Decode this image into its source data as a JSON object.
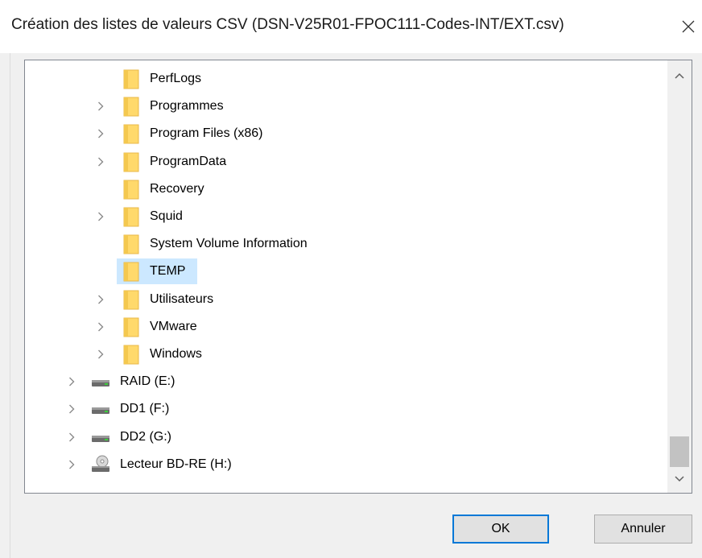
{
  "window": {
    "title": "Création des listes de valeurs CSV (DSN-V25R01-FPOC111-Codes-INT/EXT.csv)"
  },
  "tree": {
    "items": [
      {
        "label": "PerfLogs",
        "type": "folder",
        "expandable": false,
        "selected": false
      },
      {
        "label": "Programmes",
        "type": "folder",
        "expandable": true,
        "selected": false
      },
      {
        "label": "Program Files (x86)",
        "type": "folder",
        "expandable": true,
        "selected": false
      },
      {
        "label": "ProgramData",
        "type": "folder",
        "expandable": true,
        "selected": false
      },
      {
        "label": "Recovery",
        "type": "folder",
        "expandable": false,
        "selected": false
      },
      {
        "label": "Squid",
        "type": "folder",
        "expandable": true,
        "selected": false
      },
      {
        "label": "System Volume Information",
        "type": "folder",
        "expandable": false,
        "selected": false
      },
      {
        "label": "TEMP",
        "type": "folder",
        "expandable": false,
        "selected": true
      },
      {
        "label": "Utilisateurs",
        "type": "folder",
        "expandable": true,
        "selected": false
      },
      {
        "label": "VMware",
        "type": "folder",
        "expandable": true,
        "selected": false
      },
      {
        "label": "Windows",
        "type": "folder",
        "expandable": true,
        "selected": false
      },
      {
        "label": "RAID (E:)",
        "type": "drive",
        "expandable": true,
        "selected": false
      },
      {
        "label": "DD1 (F:)",
        "type": "drive",
        "expandable": true,
        "selected": false
      },
      {
        "label": "DD2 (G:)",
        "type": "drive",
        "expandable": true,
        "selected": false
      },
      {
        "label": "Lecteur BD-RE (H:)",
        "type": "optical-drive",
        "expandable": true,
        "selected": false
      }
    ]
  },
  "buttons": {
    "ok": "OK",
    "cancel": "Annuler"
  },
  "colors": {
    "folder": "#ffd96b",
    "selection": "#cce8ff",
    "default_button_border": "#0078d7"
  }
}
